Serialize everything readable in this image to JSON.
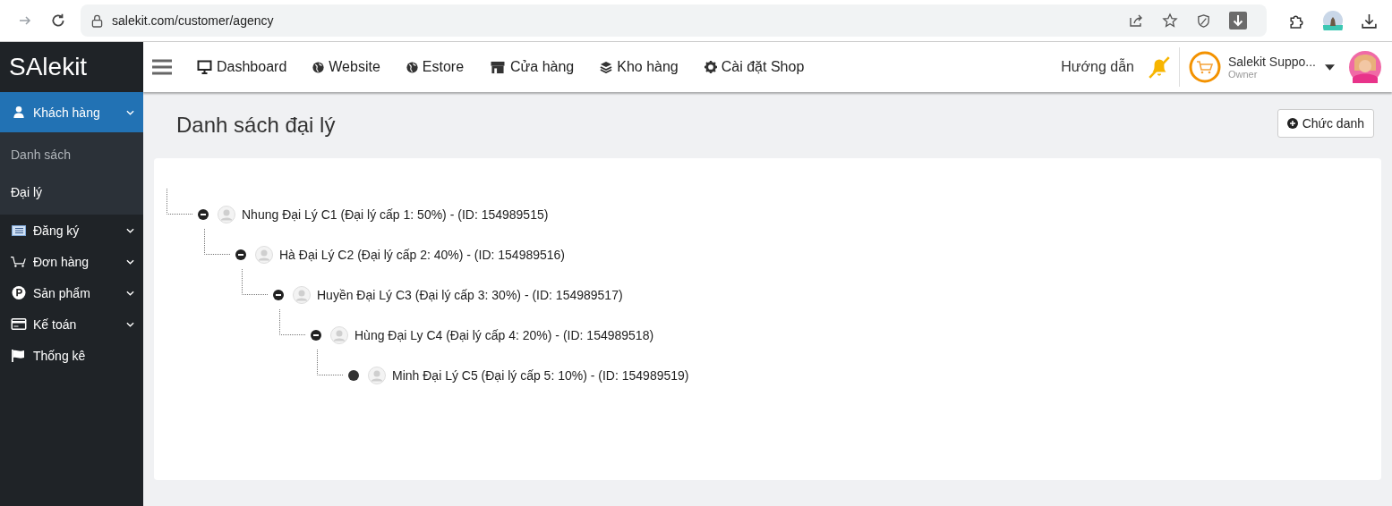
{
  "browser": {
    "url": "salekit.com/customer/agency"
  },
  "logo": "SAlekit",
  "nav": [
    {
      "label": "Dashboard"
    },
    {
      "label": "Website"
    },
    {
      "label": "Estore"
    },
    {
      "label": "Cửa hàng"
    },
    {
      "label": "Kho hàng"
    },
    {
      "label": "Cài đặt Shop"
    }
  ],
  "header": {
    "guide": "Hướng dẫn",
    "user_name": "Salekit Suppo...",
    "user_role": "Owner"
  },
  "sidebar": {
    "items": [
      {
        "label": "Khách hàng",
        "kind": "menu",
        "selected": true,
        "expanded": true,
        "children": [
          {
            "label": "Danh sách",
            "selected": false
          },
          {
            "label": "Đại lý",
            "selected": true
          }
        ]
      },
      {
        "label": "Đăng ký",
        "kind": "menu",
        "selected": false
      },
      {
        "label": "Đơn hàng",
        "kind": "menu",
        "selected": false
      },
      {
        "label": "Sản phẩm",
        "kind": "menu",
        "selected": false
      },
      {
        "label": "Kế toán",
        "kind": "menu",
        "selected": false
      },
      {
        "label": "Thống kê",
        "kind": "link",
        "selected": false
      }
    ]
  },
  "page": {
    "title": "Danh sách đại lý",
    "add_button": "Chức danh"
  },
  "tree": [
    {
      "label": "Nhung Đại Lý C1 (Đại lý cấp 1: 50%) - (ID: 154989515)",
      "expanded": true,
      "children": [
        {
          "label": "Hà Đại Lý C2 (Đại lý cấp 2: 40%) - (ID: 154989516)",
          "expanded": true,
          "children": [
            {
              "label": "Huyền Đại Lý C3 (Đại lý cấp 3: 30%) - (ID: 154989517)",
              "expanded": true,
              "children": [
                {
                  "label": "Hùng Đại Ly C4 (Đại lý cấp 4: 20%) - (ID: 154989518)",
                  "expanded": true,
                  "children": [
                    {
                      "label": "Minh Đại Lý C5 (Đại lý cấp 5: 10%) - (ID: 154989519)",
                      "expanded": false
                    }
                  ]
                }
              ]
            }
          ]
        }
      ]
    }
  ]
}
